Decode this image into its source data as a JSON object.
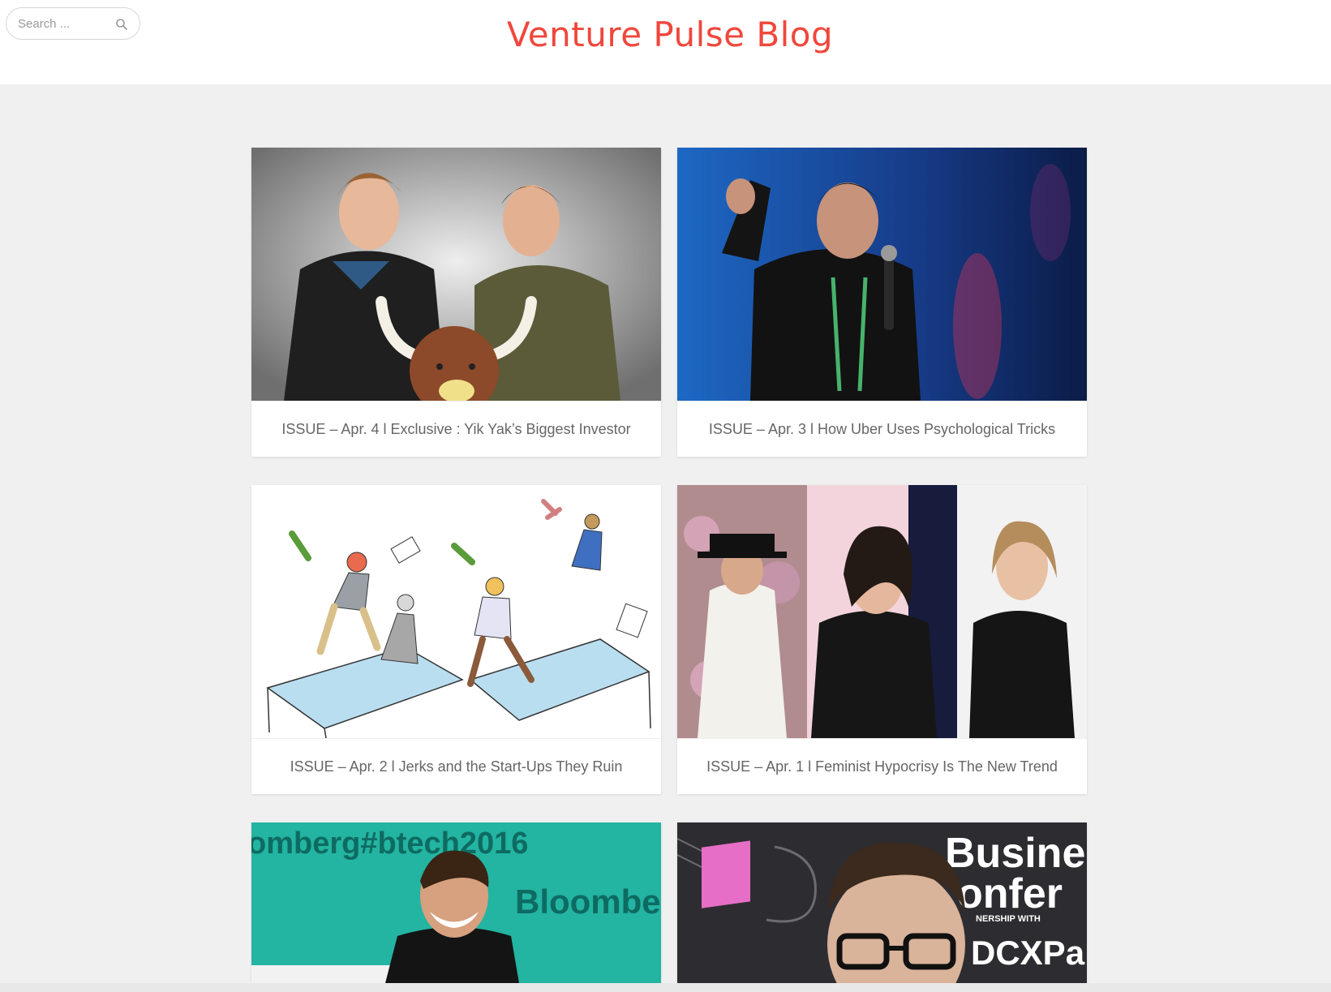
{
  "header": {
    "site_title": "Venture Pulse Blog",
    "search_placeholder": "Search ..."
  },
  "colors": {
    "brand": "#f0473c",
    "page_background": "#f0f0f0",
    "caption_text": "#666666"
  },
  "posts": [
    {
      "title": "ISSUE – Apr. 4 l Exclusive : Yik Yak’s Biggest Investor",
      "image": "two-founders-with-yak-mascot-photo"
    },
    {
      "title": "ISSUE – Apr. 3 l How Uber Uses Psychological Tricks",
      "image": "speaker-on-stage-with-microphone-photo"
    },
    {
      "title": "ISSUE – Apr. 2 l Jerks and the Start-Ups They Ruin",
      "image": "office-chaos-illustration"
    },
    {
      "title": "ISSUE – Apr. 1 l Feminist Hypocrisy Is The New Trend",
      "image": "three-women-collage-photo"
    },
    {
      "title": "",
      "image": "smiling-man-on-teal-stage-photo",
      "banner_text": "omberg#btech2016",
      "banner_text_2": "Bloombe"
    },
    {
      "title": "",
      "image": "man-with-glasses-conference-photo",
      "banner_text": "Busine",
      "banner_text_2": "onfer",
      "banner_text_3": "NERSHIP WITH",
      "banner_text_4": "DCXPa"
    }
  ]
}
